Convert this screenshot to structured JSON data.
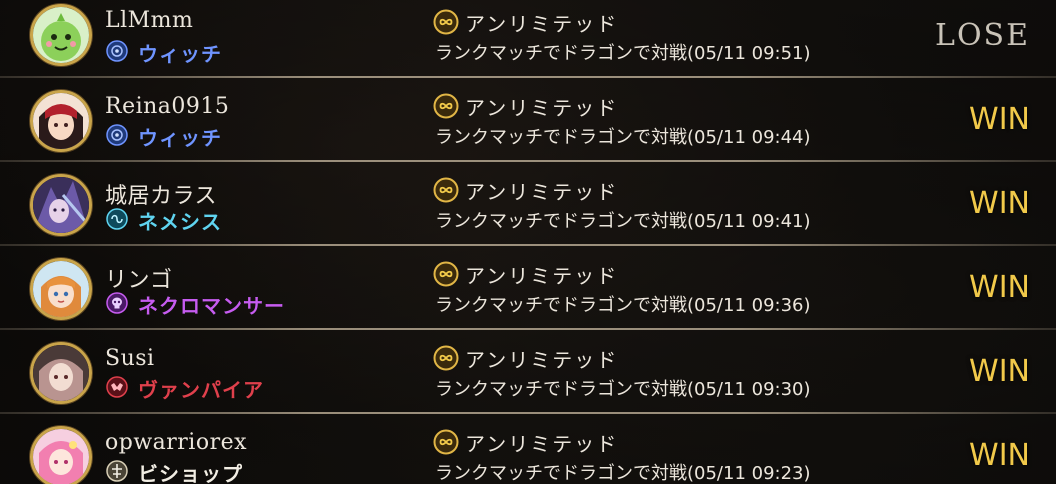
{
  "colors": {
    "win": "#f1c94a",
    "lose": "#c9c3b8",
    "witch": "#6f94ff",
    "nemesis": "#5fd4f0",
    "necromancer": "#c65cf0",
    "vampire": "#e0404c",
    "bishop": "#f2eee4",
    "gold_frame": "#c9a44a"
  },
  "history": [
    {
      "player": "LlMmm",
      "class_name": "ウィッチ",
      "class_icon": "witch-class-icon",
      "format": "アンリミテッド",
      "description": "ランクマッチでドラゴンで対戦(05/11 09:51)",
      "result": "LOSE"
    },
    {
      "player": "Reina0915",
      "class_name": "ウィッチ",
      "class_icon": "witch-class-icon",
      "format": "アンリミテッド",
      "description": "ランクマッチでドラゴンで対戦(05/11 09:44)",
      "result": "WIN"
    },
    {
      "player": "城居カラス",
      "class_name": "ネメシス",
      "class_icon": "nemesis-class-icon",
      "format": "アンリミテッド",
      "description": "ランクマッチでドラゴンで対戦(05/11 09:41)",
      "result": "WIN"
    },
    {
      "player": "リンゴ",
      "class_name": "ネクロマンサー",
      "class_icon": "necromancer-class-icon",
      "format": "アンリミテッド",
      "description": "ランクマッチでドラゴンで対戦(05/11 09:36)",
      "result": "WIN"
    },
    {
      "player": "Susi",
      "class_name": "ヴァンパイア",
      "class_icon": "vampire-class-icon",
      "format": "アンリミテッド",
      "description": "ランクマッチでドラゴンで対戦(05/11 09:30)",
      "result": "WIN"
    },
    {
      "player": "opwarriorex",
      "class_name": "ビショップ",
      "class_icon": "bishop-class-icon",
      "format": "アンリミテッド",
      "description": "ランクマッチでドラゴンで対戦(05/11 09:23)",
      "result": "WIN"
    }
  ]
}
